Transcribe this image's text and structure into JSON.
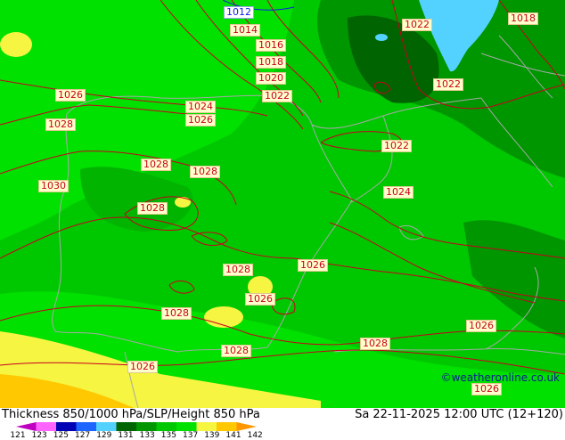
{
  "map": {
    "title": "Thickness 850/1000 hPa/SLP/Height 850 hPa",
    "valid_time": "Sa 22-11-2025 12:00 UTC (12+120)",
    "credit": "©weatheronline.co.uk",
    "colors": {
      "thickness_133": "#00c800",
      "thickness_135": "#00e100",
      "thickness_131": "#009600",
      "thickness_129": "#006400",
      "thickness_137": "#f5f542",
      "thickness_139": "#ffc800",
      "cold_127": "#53d2ff",
      "isobar": "#c8001e",
      "isobar_low": "#0a1ee6",
      "coastline": "#aaaaaa"
    },
    "isobar_labels": [
      {
        "value": "1012",
        "type": "low"
      },
      {
        "value": "1014",
        "type": "normal"
      },
      {
        "value": "1016",
        "type": "normal"
      },
      {
        "value": "1018",
        "type": "normal"
      },
      {
        "value": "1020",
        "type": "normal"
      },
      {
        "value": "1022",
        "type": "normal"
      },
      {
        "value": "1022",
        "type": "normal"
      },
      {
        "value": "1018",
        "type": "normal"
      },
      {
        "value": "1022",
        "type": "normal"
      },
      {
        "value": "1022",
        "type": "normal"
      },
      {
        "value": "1024",
        "type": "normal"
      },
      {
        "value": "1026",
        "type": "normal"
      },
      {
        "value": "1026",
        "type": "normal"
      },
      {
        "value": "1028",
        "type": "normal"
      },
      {
        "value": "1028",
        "type": "normal"
      },
      {
        "value": "1028",
        "type": "normal"
      },
      {
        "value": "1030",
        "type": "normal"
      },
      {
        "value": "1028",
        "type": "normal"
      },
      {
        "value": "1024",
        "type": "normal"
      },
      {
        "value": "1028",
        "type": "normal"
      },
      {
        "value": "1026",
        "type": "normal"
      },
      {
        "value": "1026",
        "type": "normal"
      },
      {
        "value": "1028",
        "type": "normal"
      },
      {
        "value": "1028",
        "type": "normal"
      },
      {
        "value": "1028",
        "type": "normal"
      },
      {
        "value": "1026",
        "type": "normal"
      },
      {
        "value": "1026",
        "type": "normal"
      },
      {
        "value": "1026",
        "type": "normal"
      }
    ]
  },
  "legend": {
    "ticks": [
      "121",
      "123",
      "125",
      "127",
      "129",
      "131",
      "133",
      "135",
      "137",
      "139",
      "141",
      "142"
    ],
    "colors": [
      "#c000c0",
      "#ff64ff",
      "#0000b4",
      "#1e64ff",
      "#53d2ff",
      "#006400",
      "#009600",
      "#00c800",
      "#00e100",
      "#f5f542",
      "#ffc800",
      "#ff9600"
    ]
  }
}
